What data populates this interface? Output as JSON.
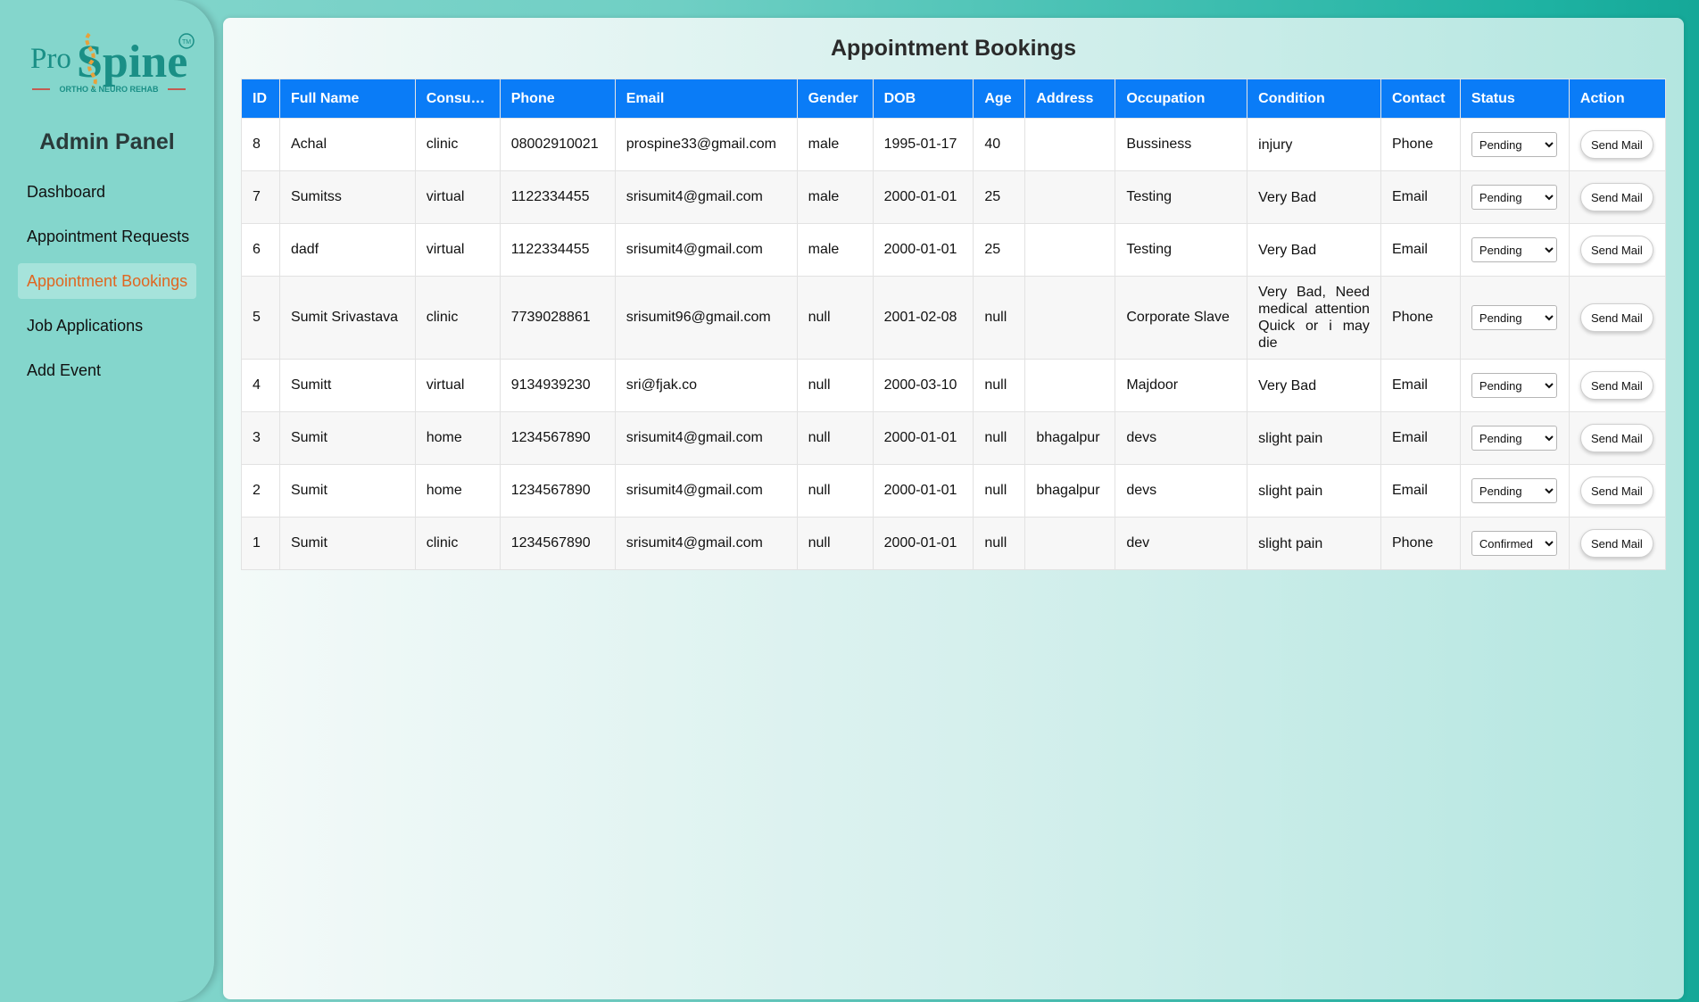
{
  "brand": {
    "logo_text_pro": "Pro",
    "logo_text_spine": "Spine",
    "logo_tm": "TM",
    "logo_tagline": "ORTHO & NEURO REHAB"
  },
  "sidebar": {
    "title": "Admin Panel",
    "items": [
      {
        "label": "Dashboard",
        "active": false
      },
      {
        "label": "Appointment Requests",
        "active": false
      },
      {
        "label": "Appointment Bookings",
        "active": true
      },
      {
        "label": "Job Applications",
        "active": false
      },
      {
        "label": "Add Event",
        "active": false
      }
    ]
  },
  "main": {
    "title": "Appointment Bookings",
    "columns": [
      "ID",
      "Full Name",
      "Consu…",
      "Phone",
      "Email",
      "Gender",
      "DOB",
      "Age",
      "Address",
      "Occupation",
      "Condition",
      "Contact",
      "Status",
      "Action"
    ],
    "status_options": [
      "Pending",
      "Confirmed"
    ],
    "action_label": "Send Mail",
    "rows": [
      {
        "id": "8",
        "name": "Achal",
        "consult": "clinic",
        "phone": "08002910021",
        "email": "prospine33@gmail.com",
        "gender": "male",
        "dob": "1995-01-17",
        "age": "40",
        "address": "",
        "occupation": "Bussiness",
        "condition": "injury",
        "contact": "Phone",
        "status": "Pending"
      },
      {
        "id": "7",
        "name": "Sumitss",
        "consult": "virtual",
        "phone": "1122334455",
        "email": "srisumit4@gmail.com",
        "gender": "male",
        "dob": "2000-01-01",
        "age": "25",
        "address": "",
        "occupation": "Testing",
        "condition": "Very Bad",
        "contact": "Email",
        "status": "Pending"
      },
      {
        "id": "6",
        "name": "dadf",
        "consult": "virtual",
        "phone": "1122334455",
        "email": "srisumit4@gmail.com",
        "gender": "male",
        "dob": "2000-01-01",
        "age": "25",
        "address": "",
        "occupation": "Testing",
        "condition": "Very Bad",
        "contact": "Email",
        "status": "Pending"
      },
      {
        "id": "5",
        "name": "Sumit Srivastava",
        "consult": "clinic",
        "phone": "7739028861",
        "email": "srisumit96@gmail.com",
        "gender": "null",
        "dob": "2001-02-08",
        "age": "null",
        "address": "",
        "occupation": "Corporate Slave",
        "condition": "Very Bad, Need medical attention Quick or i may die",
        "contact": "Phone",
        "status": "Pending"
      },
      {
        "id": "4",
        "name": "Sumitt",
        "consult": "virtual",
        "phone": "9134939230",
        "email": "sri@fjak.co",
        "gender": "null",
        "dob": "2000-03-10",
        "age": "null",
        "address": "",
        "occupation": "Majdoor",
        "condition": "Very Bad",
        "contact": "Email",
        "status": "Pending"
      },
      {
        "id": "3",
        "name": "Sumit",
        "consult": "home",
        "phone": "1234567890",
        "email": "srisumit4@gmail.com",
        "gender": "null",
        "dob": "2000-01-01",
        "age": "null",
        "address": "bhagalpur",
        "occupation": "devs",
        "condition": "slight pain",
        "contact": "Email",
        "status": "Pending"
      },
      {
        "id": "2",
        "name": "Sumit",
        "consult": "home",
        "phone": "1234567890",
        "email": "srisumit4@gmail.com",
        "gender": "null",
        "dob": "2000-01-01",
        "age": "null",
        "address": "bhagalpur",
        "occupation": "devs",
        "condition": "slight pain",
        "contact": "Email",
        "status": "Pending"
      },
      {
        "id": "1",
        "name": "Sumit",
        "consult": "clinic",
        "phone": "1234567890",
        "email": "srisumit4@gmail.com",
        "gender": "null",
        "dob": "2000-01-01",
        "age": "null",
        "address": "",
        "occupation": "dev",
        "condition": "slight pain",
        "contact": "Phone",
        "status": "Confirmed"
      }
    ]
  },
  "colors": {
    "header_blue": "#0a7cf7",
    "active_nav_text": "#e06620",
    "brand_teal": "#1a8f86",
    "brand_orange": "#e8a13a",
    "brand_red": "#d8322a"
  }
}
